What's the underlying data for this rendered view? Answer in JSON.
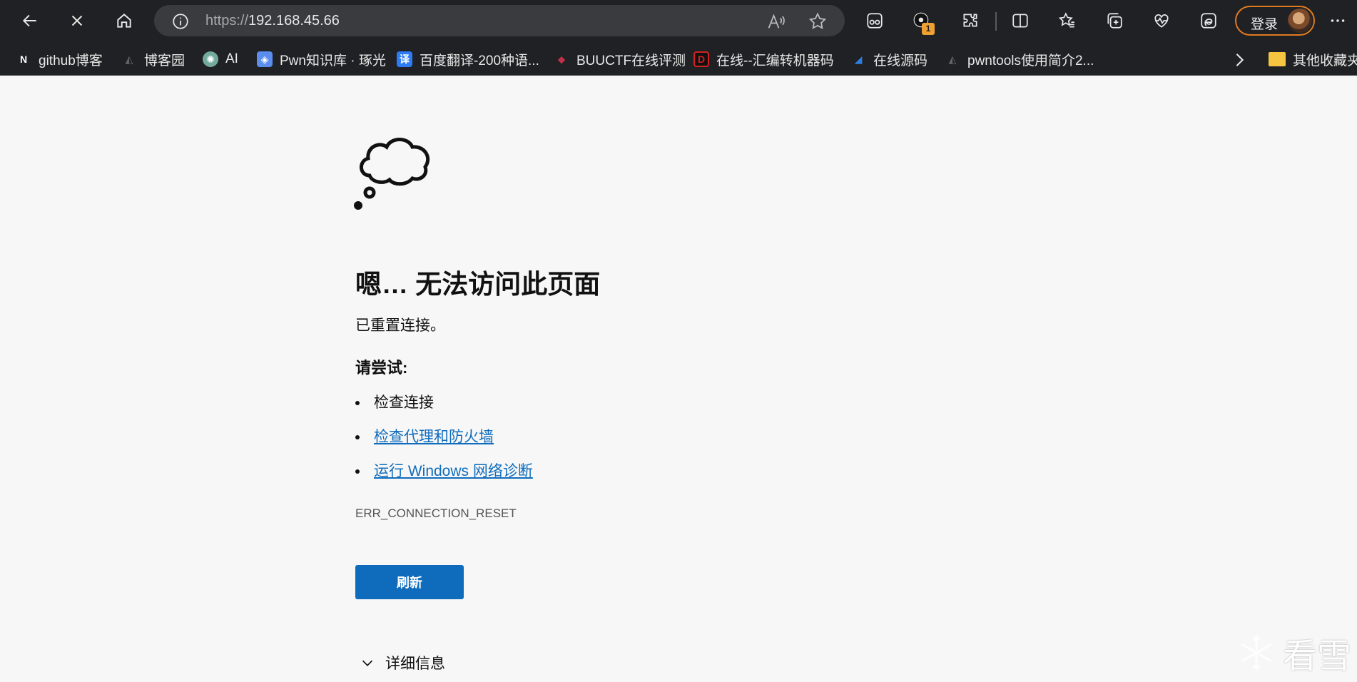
{
  "browser": {
    "url_scheme": "https://",
    "url_host": "192.168.45.66",
    "login_label": "登录",
    "extension_badge": "1"
  },
  "bookmarks": [
    {
      "label": "github博客",
      "icon": "N",
      "icon_color": "#ffffff"
    },
    {
      "label": "博客园",
      "icon": "",
      "icon_color": "#555555"
    },
    {
      "label": "AI",
      "icon": "",
      "icon_color": "#74aa9c"
    },
    {
      "label": "Pwn知识库 · 琢光",
      "icon": "",
      "icon_color": "#5b8def"
    },
    {
      "label": "百度翻译-200种语...",
      "icon": "译",
      "icon_color": "#2d7cf6"
    },
    {
      "label": "BUUCTF在线评测",
      "icon": "",
      "icon_color": "#c0304a"
    },
    {
      "label": "在线--汇编转机器码",
      "icon": "D",
      "icon_color": "#d42020"
    },
    {
      "label": "在线源码",
      "icon": "",
      "icon_color": "#2a7fe0"
    },
    {
      "label": "pwntools使用简介2...",
      "icon": "",
      "icon_color": "#555555"
    }
  ],
  "other_bookmarks": "其他收藏夹",
  "error": {
    "title": "嗯… 无法访问此页面",
    "message": "已重置连接。",
    "try_heading": "请尝试:",
    "suggestions": [
      "检查连接",
      "检查代理和防火墙",
      "运行 Windows 网络诊断"
    ],
    "code": "ERR_CONNECTION_RESET",
    "refresh_label": "刷新",
    "details_label": "详细信息"
  },
  "watermark": "看雪",
  "colors": {
    "accent": "#0f6cbd",
    "login_border": "#e07a1e",
    "chrome_bg": "#202124"
  }
}
